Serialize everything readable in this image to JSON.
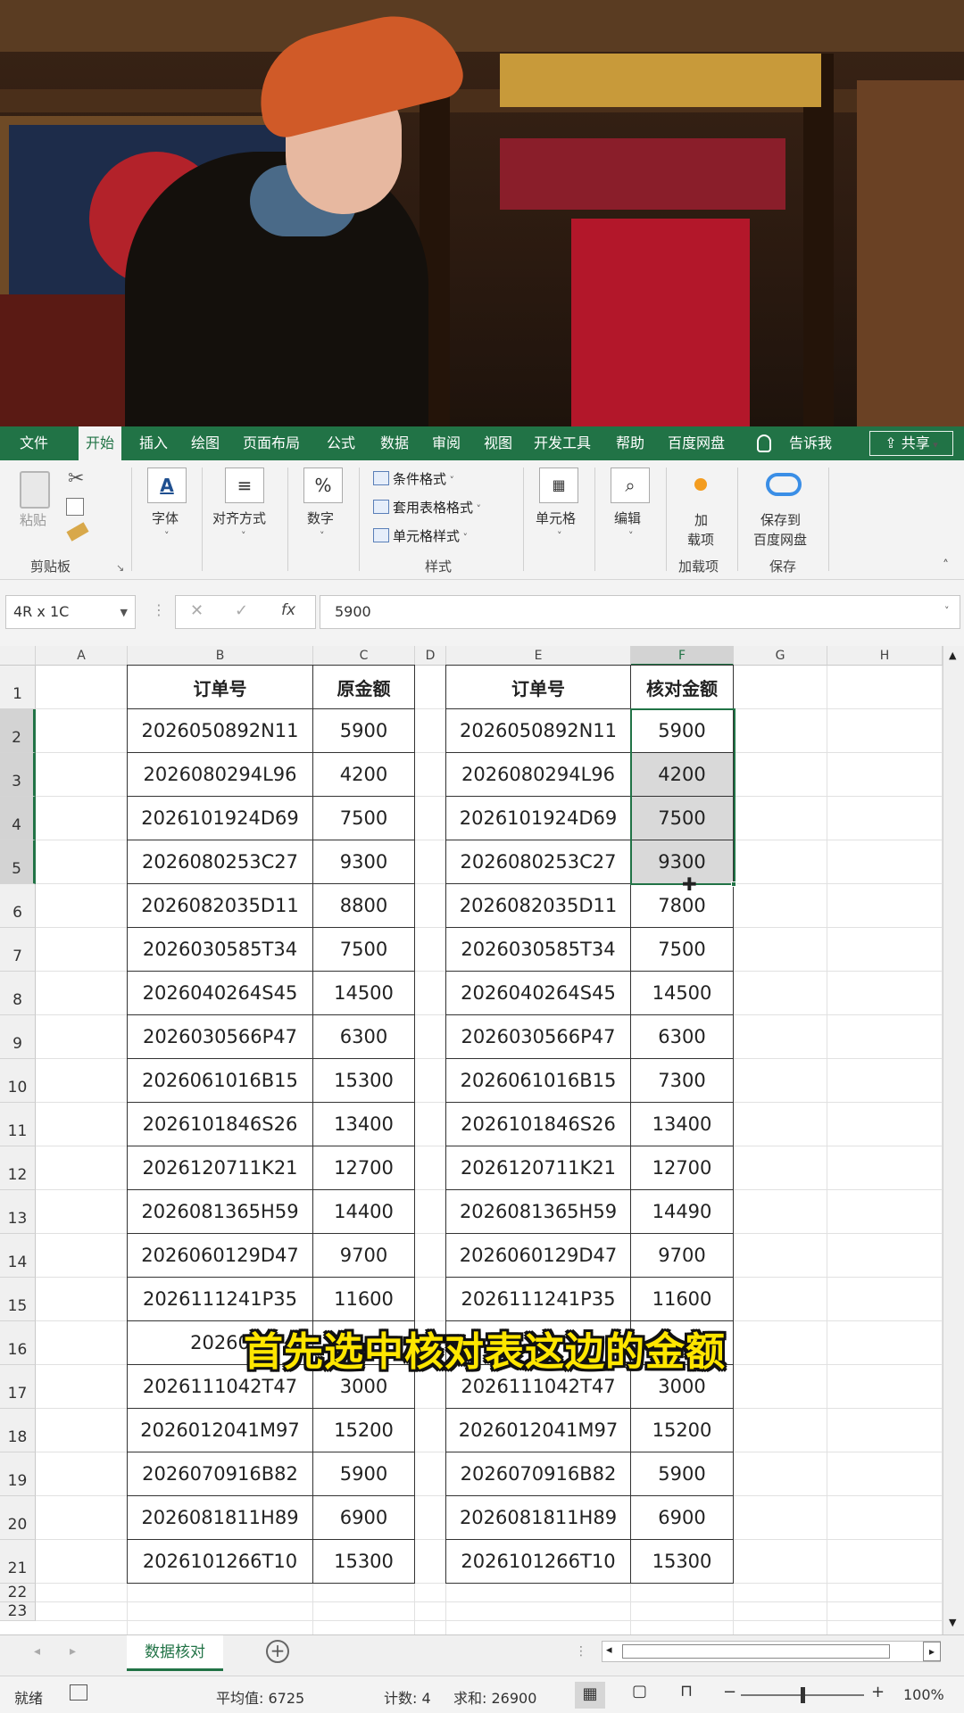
{
  "ribbon": {
    "tabs": [
      "文件",
      "开始",
      "插入",
      "绘图",
      "页面布局",
      "公式",
      "数据",
      "审阅",
      "视图",
      "开发工具",
      "帮助",
      "百度网盘",
      "告诉我"
    ],
    "share_label": "共享",
    "clipboard": {
      "paste": "粘贴",
      "group": "剪贴板"
    },
    "font": "字体",
    "align": "对齐方式",
    "number": "数字",
    "styles": {
      "conditional": "条件格式",
      "table": "套用表格格式",
      "cell_style": "单元格样式",
      "group": "样式"
    },
    "cells": "单元格",
    "edit": "编辑",
    "addins": {
      "label1": "加",
      "label2": "载项",
      "group": "加载项"
    },
    "save": {
      "label1": "保存到",
      "label2": "百度网盘",
      "group": "保存"
    }
  },
  "formula_bar": {
    "name_box": "4R x 1C",
    "fx": "fx",
    "value": "5900"
  },
  "columns": [
    "A",
    "B",
    "C",
    "D",
    "E",
    "F",
    "G",
    "H"
  ],
  "rows": [
    "1",
    "2",
    "3",
    "4",
    "5",
    "6",
    "7",
    "8",
    "9",
    "10",
    "11",
    "12",
    "13",
    "14",
    "15",
    "16",
    "17",
    "18",
    "19",
    "20",
    "21",
    "22",
    "23"
  ],
  "table_left": {
    "headers": [
      "订单号",
      "原金额"
    ],
    "rows": [
      [
        "2026050892N11",
        "5900"
      ],
      [
        "2026080294L96",
        "4200"
      ],
      [
        "2026101924D69",
        "7500"
      ],
      [
        "2026080253C27",
        "9300"
      ],
      [
        "2026082035D11",
        "8800"
      ],
      [
        "2026030585T34",
        "7500"
      ],
      [
        "2026040264S45",
        "14500"
      ],
      [
        "2026030566P47",
        "6300"
      ],
      [
        "2026061016B15",
        "15300"
      ],
      [
        "2026101846S26",
        "13400"
      ],
      [
        "2026120711K21",
        "12700"
      ],
      [
        "2026081365H59",
        "14400"
      ],
      [
        "2026060129D47",
        "9700"
      ],
      [
        "2026111241P35",
        "11600"
      ],
      [
        "20260",
        ""
      ],
      [
        "2026111042T47",
        "3000"
      ],
      [
        "2026012041M97",
        "15200"
      ],
      [
        "2026070916B82",
        "5900"
      ],
      [
        "2026081811H89",
        "6900"
      ],
      [
        "2026101266T10",
        "15300"
      ]
    ]
  },
  "table_right": {
    "headers": [
      "订单号",
      "核对金额"
    ],
    "rows": [
      [
        "2026050892N11",
        "5900"
      ],
      [
        "2026080294L96",
        "4200"
      ],
      [
        "2026101924D69",
        "7500"
      ],
      [
        "2026080253C27",
        "9300"
      ],
      [
        "2026082035D11",
        "7800"
      ],
      [
        "2026030585T34",
        "7500"
      ],
      [
        "2026040264S45",
        "14500"
      ],
      [
        "2026030566P47",
        "6300"
      ],
      [
        "2026061016B15",
        "7300"
      ],
      [
        "2026101846S26",
        "13400"
      ],
      [
        "2026120711K21",
        "12700"
      ],
      [
        "2026081365H59",
        "14490"
      ],
      [
        "2026060129D47",
        "9700"
      ],
      [
        "2026111241P35",
        "11600"
      ],
      [
        "",
        ""
      ],
      [
        "2026111042T47",
        "3000"
      ],
      [
        "2026012041M97",
        "15200"
      ],
      [
        "2026070916B82",
        "5900"
      ],
      [
        "2026081811H89",
        "6900"
      ],
      [
        "2026101266T10",
        "15300"
      ]
    ]
  },
  "caption": "首先选中核对表这边的金额",
  "sheet_tab": "数据核对",
  "status": {
    "ready": "就绪",
    "average": "平均值: 6725",
    "count": "计数: 4",
    "sum": "求和: 26900",
    "zoom": "100%"
  },
  "colors": {
    "excel_green": "#217346",
    "header_fill": "#92d17a",
    "caption": "#ffe600"
  }
}
